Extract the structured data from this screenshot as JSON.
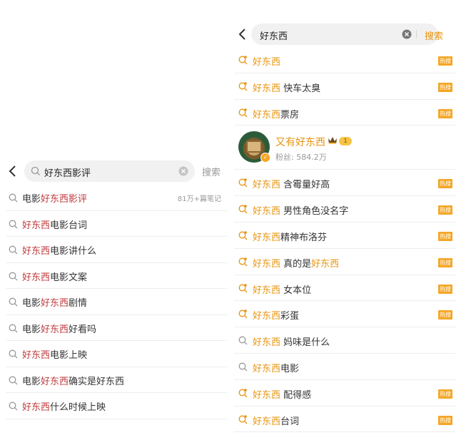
{
  "left": {
    "query": "好东西影评",
    "search_label": "搜索",
    "suggestions": [
      {
        "pre": "电影",
        "hl": "好东西影评",
        "post": "",
        "count": "81万+篇笔记"
      },
      {
        "pre": "",
        "hl": "好东西",
        "post": "电影台词",
        "count": ""
      },
      {
        "pre": "",
        "hl": "好东西",
        "post": "电影讲什么",
        "count": ""
      },
      {
        "pre": "",
        "hl": "好东西",
        "post": "电影文案",
        "count": ""
      },
      {
        "pre": "电影",
        "hl": "好东西",
        "post": "剧情",
        "count": ""
      },
      {
        "pre": "电影",
        "hl": "好东西",
        "post": "好看吗",
        "count": ""
      },
      {
        "pre": "",
        "hl": "好东西",
        "post": "电影上映",
        "count": ""
      },
      {
        "pre": "电影",
        "hl": "好东西",
        "post": "确实是好东西",
        "count": ""
      },
      {
        "pre": "",
        "hl": "好东西",
        "post": "什么时候上映",
        "count": ""
      }
    ]
  },
  "right": {
    "query": "好东西",
    "search_label": "搜索",
    "hot_label": "热搜",
    "user": {
      "name": "又有好东西",
      "level": "1",
      "fans": "粉丝: 584.2万"
    },
    "rows_top": [
      {
        "hl": "好东西",
        "post": "",
        "post_hl": "",
        "hot": true
      },
      {
        "hl": "好东西",
        "post": " 快车太臭",
        "post_hl": "",
        "hot": true
      },
      {
        "hl": "好东西",
        "post": "票房",
        "post_hl": "",
        "hot": true
      }
    ],
    "rows_bottom": [
      {
        "hl": "好东西",
        "post": " 含霉量好高",
        "post_hl": "",
        "hot": true
      },
      {
        "hl": "好东西",
        "post": " 男性角色没名字",
        "post_hl": "",
        "hot": true
      },
      {
        "hl": "好东西",
        "post": "精神布洛芬",
        "post_hl": "",
        "hot": true
      },
      {
        "hl": "好东西",
        "post": " 真的是",
        "post_hl": "好东西",
        "hot": true
      },
      {
        "hl": "好东西",
        "post": " 女本位",
        "post_hl": "",
        "hot": true
      },
      {
        "hl": "好东西",
        "post": "彩蛋",
        "post_hl": "",
        "hot": true
      },
      {
        "hl": "好东西",
        "post": " 妈味是什么",
        "post_hl": "",
        "hot": false
      },
      {
        "hl": "好东西",
        "post": "电影",
        "post_hl": "",
        "hot": false
      },
      {
        "hl": "好东西",
        "post": " 配得感",
        "post_hl": "",
        "hot": true
      },
      {
        "hl": "好东西",
        "post": "台词",
        "post_hl": "",
        "hot": true
      }
    ]
  },
  "colors": {
    "highlight_left": "#c0393b",
    "highlight_right": "#e8940f",
    "hot_tag": "#f5a623"
  },
  "icons": [
    "back-icon",
    "search-icon",
    "clear-icon",
    "hot-search-icon",
    "crown-icon",
    "verified-icon"
  ]
}
